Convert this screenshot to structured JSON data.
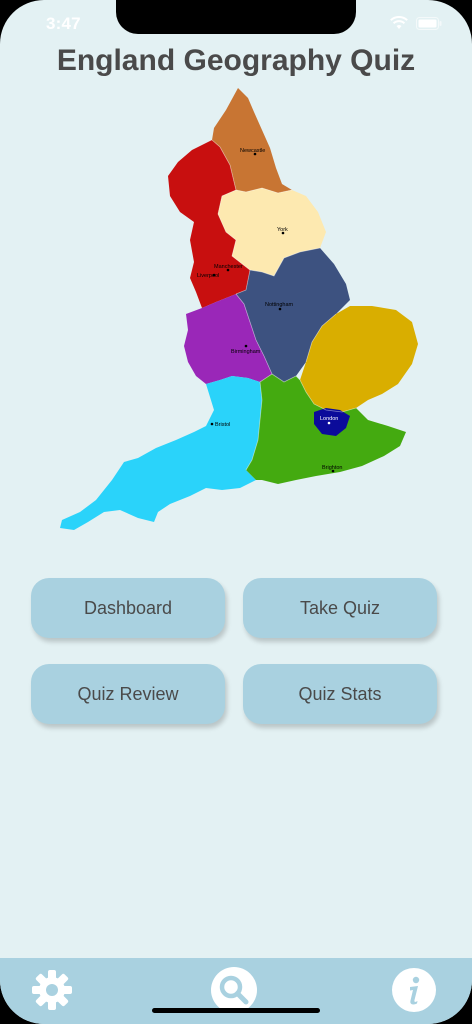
{
  "status": {
    "time": "3:47"
  },
  "app": {
    "title": "England Geography Quiz"
  },
  "map": {
    "cities": {
      "newcastle": "Newcastle",
      "york": "York",
      "manchester": "Manchester",
      "liverpool": "Liverpool",
      "nottingham": "Nottingham",
      "birmingham": "Birmingham",
      "bristol": "Bristol",
      "london": "London",
      "brighton": "Brighton"
    },
    "region_colors": {
      "north_east": "#c87533",
      "north_west": "#c80f0f",
      "yorkshire": "#fde9b0",
      "east_midlands": "#3d5280",
      "west_midlands": "#9a27b8",
      "east_of_england": "#d9ae00",
      "south_west": "#2ad3fa",
      "south_east": "#44aa10",
      "london": "#0b0b9a"
    }
  },
  "menu": {
    "dashboard": "Dashboard",
    "take_quiz": "Take Quiz",
    "quiz_review": "Quiz Review",
    "quiz_stats": "Quiz Stats"
  },
  "tabbar": {
    "icons": [
      "gear-icon",
      "search-icon",
      "info-icon"
    ]
  },
  "colors": {
    "background": "#e3f1f3",
    "button": "#a9d1e0",
    "text": "#4a4a4a"
  }
}
